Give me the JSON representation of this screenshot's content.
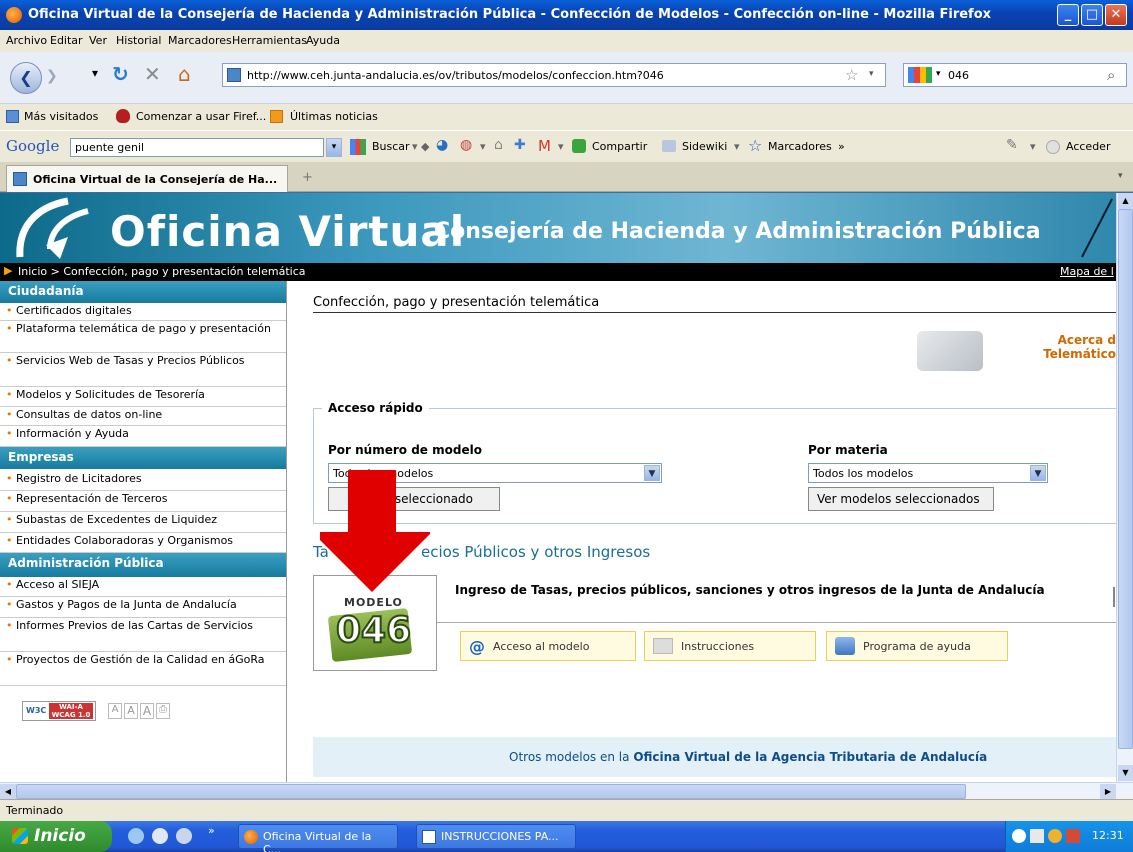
{
  "window": {
    "title": "Oficina Virtual de la Consejería de Hacienda y Administración Pública - Confección de Modelos - Confección on-line - Mozilla Firefox"
  },
  "menu": [
    "Archivo",
    "Editar",
    "Ver",
    "Historial",
    "Marcadores",
    "Herramientas",
    "Ayuda"
  ],
  "nav": {
    "url": "http://www.ceh.junta-andalucia.es/ov/tributos/modelos/confeccion.htm?046",
    "search_value": "046"
  },
  "bookmarks": [
    "Más visitados",
    "Comenzar a usar Firef...",
    "Últimas noticias"
  ],
  "google_toolbar": {
    "logo": "Google",
    "search_value": "puente genil",
    "buscar": "Buscar",
    "compartir": "Compartir",
    "sidewiki": "Sidewiki",
    "marcadores": "Marcadores",
    "more": "»",
    "acceder": "Acceder"
  },
  "tab": {
    "title": "Oficina Virtual de la Consejería de Ha...",
    "new_tab": "+"
  },
  "banner": {
    "title": "Oficina Virtual",
    "subtitle": "Consejería de Hacienda y Administración Pública"
  },
  "breadcrumb": {
    "text": "Inicio > Confección, pago y presentación telemática",
    "mapa": "Mapa de l"
  },
  "sidebar": {
    "sections": [
      {
        "title": "Ciudadanía",
        "items": [
          "Certificados digitales",
          "Plataforma telemática de pago y presentación",
          "Servicios Web de Tasas y Precios Públicos",
          "Modelos y Solicitudes de Tesorería",
          "Consultas de datos on-line",
          "Información y Ayuda"
        ]
      },
      {
        "title": "Empresas",
        "items": [
          "Registro de Licitadores",
          "Representación de Terceros",
          "Subastas de Excedentes de Liquidez",
          "Entidades Colaboradoras y Organismos"
        ]
      },
      {
        "title": "Administración Pública",
        "items": [
          "Acceso al SIEJA",
          "Gastos y Pagos de la Junta de Andalucía",
          "Informes Previos de las Cartas de Servicios",
          "Proyectos de Gestión de la Calidad en áGoRa"
        ]
      }
    ],
    "wai_badge": "WAI-A WCAG 1.0",
    "w3c": "W3C",
    "font_sizes": [
      "A",
      "A",
      "A"
    ]
  },
  "main": {
    "heading": "Confección, pago y presentación telemática",
    "acerca": {
      "line1": "Acerca d",
      "line2": "Telemático"
    },
    "acceso_rapido": "Acceso rápido",
    "por_numero": {
      "label": "Por número de modelo",
      "selected": "Todos los modelos",
      "button": "Ver modelo seleccionado",
      "button_visible": "elo seleccionado"
    },
    "por_materia": {
      "label": "Por materia",
      "selected": "Todos los modelos",
      "button": "Ver modelos seleccionados"
    },
    "section_title_left": "Ta",
    "section_title_right": "ecios Públicos y otros Ingresos",
    "modelo": {
      "badge_top": "MODELO",
      "badge_num": "046",
      "description": "Ingreso de Tasas, precios públicos, sanciones y otros ingresos de la Junta de Andalucía"
    },
    "actions": [
      "Acceso al modelo",
      "Instrucciones",
      "Programa de ayuda"
    ],
    "footer_prefix": "Otros modelos en la ",
    "footer_link": "Oficina Virtual de la Agencia Tributaria de Andalucía"
  },
  "status": "Terminado",
  "taskbar": {
    "start": "Inicio",
    "items": [
      "Oficina Virtual de la C...",
      "INSTRUCCIONES PA..."
    ],
    "clock": "12:31"
  },
  "colors": {
    "arrow": "#e00000",
    "teal": "#1a7fa3",
    "link_blue": "#0d4d8a"
  }
}
